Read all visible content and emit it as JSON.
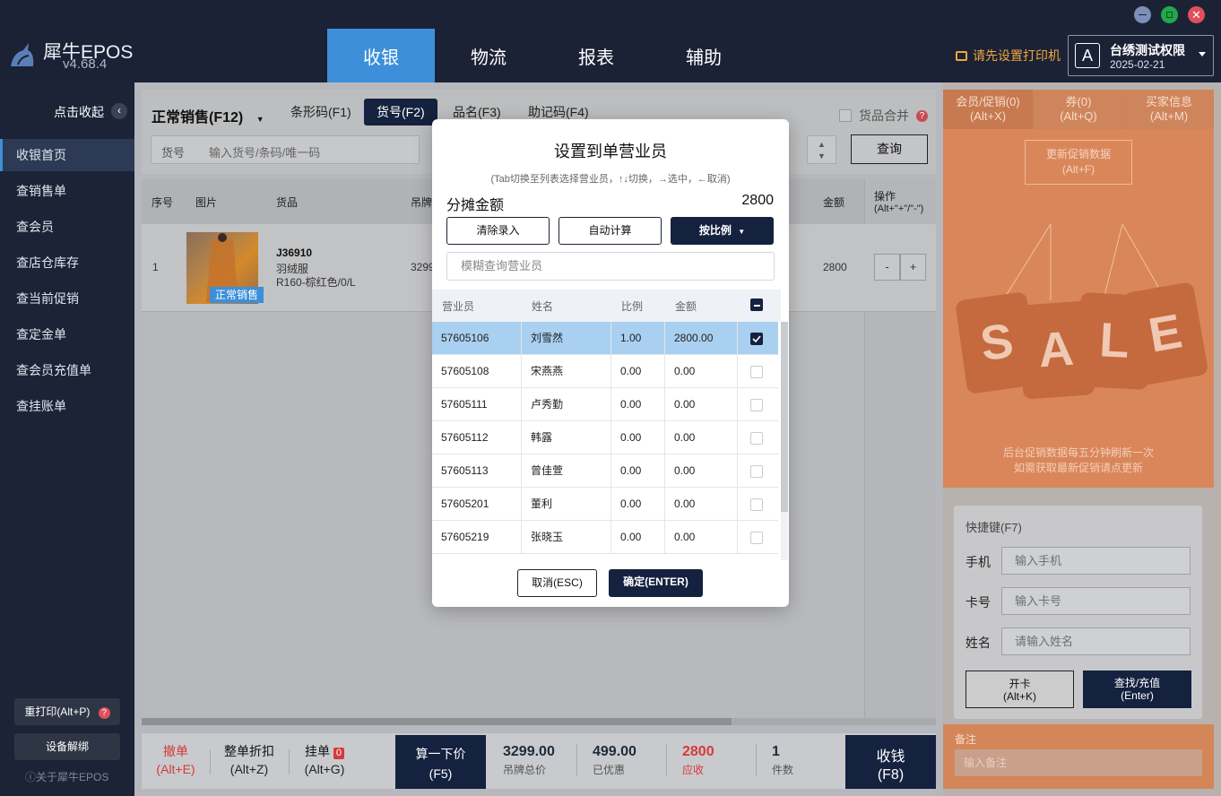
{
  "app": {
    "name": "犀牛EPOS",
    "version": "v4.68.4"
  },
  "nav": [
    "收银",
    "物流",
    "报表",
    "辅助"
  ],
  "header": {
    "printer_warning": "请先设置打印机",
    "account_name": "台绣测试权限",
    "account_badge": "A",
    "account_date": "2025-02-21"
  },
  "sidebar": {
    "collapse_label": "点击收起",
    "items": [
      "收银首页",
      "查销售单",
      "查会员",
      "查店仓库存",
      "查当前促销",
      "查定金单",
      "查会员充值单",
      "查挂账单"
    ],
    "reprint": "重打印(Alt+P)",
    "device_unbind": "设备解绑",
    "about": "ⓘ关于犀牛EPOS"
  },
  "toolbar": {
    "sale_type": "正常销售(F12)",
    "tabs": [
      "条形码(F1)",
      "货号(F2)",
      "品名(F3)",
      "助记码(F4)"
    ],
    "search_label": "货号",
    "search_placeholder": "输入货号/条码/唯一码",
    "merge_label": "货品合并",
    "query_button": "查询"
  },
  "table": {
    "headers": [
      "序号",
      "图片",
      "货品",
      "吊牌",
      "金额",
      "操作",
      "(Alt+\"+\"/\"-\")"
    ],
    "rows": [
      {
        "index": "1",
        "tag": "正常销售",
        "code": "J36910",
        "name": "羽绒服",
        "spec": "R160-棕红色/0/L",
        "price": "3299",
        "amount": "2800",
        "minus": "-",
        "plus": "+"
      }
    ]
  },
  "bottom": {
    "revoke": "撤单",
    "revoke_key": "(Alt+E)",
    "discount": "整单折扣",
    "discount_key": "(Alt+Z)",
    "hold": "挂单",
    "hold_count": "0",
    "hold_key": "(Alt+G)",
    "calc": "算一下价",
    "calc_key": "(F5)",
    "tag_total": "3299.00",
    "tag_total_label": "吊牌总价",
    "discounted": "499.00",
    "discounted_label": "已优惠",
    "receivable": "2800",
    "receivable_label": "应收",
    "count": "1",
    "count_label": "件数",
    "checkout": "收钱",
    "checkout_key": "(F8)"
  },
  "right": {
    "tabs": [
      {
        "label": "会员/促销(0)",
        "key": "(Alt+X)"
      },
      {
        "label": "券(0)",
        "key": "(Alt+Q)"
      },
      {
        "label": "买家信息",
        "key": "(Alt+M)"
      }
    ],
    "update_button": "更新促销数据",
    "update_key": "(Alt+F)",
    "sale_letters": [
      "S",
      "A",
      "L",
      "E"
    ],
    "note1": "后台促销数据每五分钟刷新一次",
    "note2": "如需获取最新促销请点更新",
    "quick_title": "快捷键(F7)",
    "phone_label": "手机",
    "phone_placeholder": "输入手机",
    "card_label": "卡号",
    "card_placeholder": "输入卡号",
    "name_label": "姓名",
    "name_placeholder": "请输入姓名",
    "open_card": "开卡",
    "open_card_key": "(Alt+K)",
    "find_recharge": "查找/充值",
    "find_recharge_key": "(Enter)",
    "remark_label": "备注",
    "remark_placeholder": "输入备注"
  },
  "modal": {
    "title": "设置到单营业员",
    "hint": "(Tab切换至列表选择营业员，↑↓切换，→选中，←取消)",
    "amount_label": "分摊金额",
    "amount_value": "2800",
    "clear": "清除录入",
    "auto": "自动计算",
    "by_ratio": "按比例",
    "search_placeholder": "模糊查询营业员",
    "headers": [
      "营业员",
      "姓名",
      "比例",
      "金额"
    ],
    "rows": [
      {
        "id": "57605106",
        "name": "刘雪然",
        "ratio": "1.00",
        "amount": "2800.00",
        "checked": true
      },
      {
        "id": "57605108",
        "name": "宋燕燕",
        "ratio": "0.00",
        "amount": "0.00",
        "checked": false
      },
      {
        "id": "57605111",
        "name": "卢秀勤",
        "ratio": "0.00",
        "amount": "0.00",
        "checked": false
      },
      {
        "id": "57605112",
        "name": "韩露",
        "ratio": "0.00",
        "amount": "0.00",
        "checked": false
      },
      {
        "id": "57605113",
        "name": "曾佳萱",
        "ratio": "0.00",
        "amount": "0.00",
        "checked": false
      },
      {
        "id": "57605201",
        "name": "董利",
        "ratio": "0.00",
        "amount": "0.00",
        "checked": false
      },
      {
        "id": "57605219",
        "name": "张晓玉",
        "ratio": "0.00",
        "amount": "0.00",
        "checked": false
      }
    ],
    "cancel": "取消(ESC)",
    "confirm": "确定(ENTER)"
  }
}
